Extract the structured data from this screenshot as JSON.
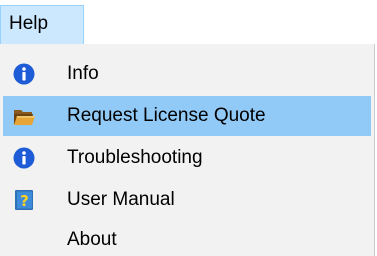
{
  "menubar": {
    "title": "Help"
  },
  "menu": {
    "items": [
      {
        "label": "Info",
        "icon": "info-icon",
        "highlighted": false
      },
      {
        "label": "Request License Quote",
        "icon": "folder-open-icon",
        "highlighted": true
      },
      {
        "label": "Troubleshooting",
        "icon": "info-icon",
        "highlighted": false
      },
      {
        "label": "User Manual",
        "icon": "help-book-icon",
        "highlighted": false
      },
      {
        "label": "About",
        "icon": "",
        "highlighted": false
      }
    ]
  },
  "colors": {
    "highlight": "#91c9f7",
    "menu_background": "#f2f2f2",
    "menubar_selected": "#cce8ff",
    "info_icon": "#1e5bd6"
  }
}
